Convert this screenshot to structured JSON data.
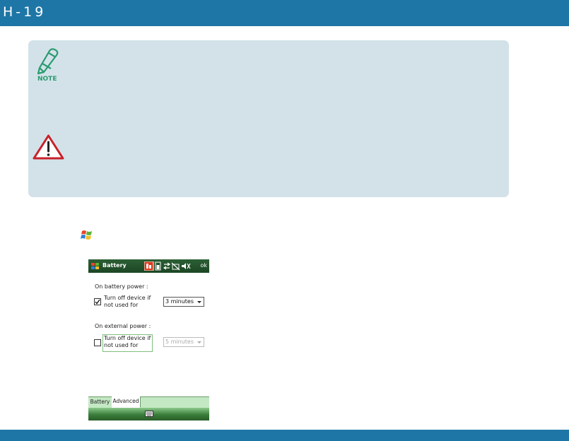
{
  "header": {
    "title": "H-19"
  },
  "note": {
    "label": "NOTE"
  },
  "device": {
    "title": "Battery",
    "ok_label": "ok",
    "battery_section": "On battery power :",
    "battery_check_label_1": "Turn off device if",
    "battery_check_label_2": "not used for",
    "battery_checked": true,
    "battery_value": "3 minutes",
    "external_section": "On external power :",
    "external_check_label_1": "Turn off device if",
    "external_check_label_2": "not used for",
    "external_checked": false,
    "external_value": "5 minutes",
    "tabs": [
      {
        "label": "Battery"
      },
      {
        "label": "Advanced"
      }
    ]
  },
  "colors": {
    "header_bg": "#1e76a6",
    "note_bg": "#d3e2e9",
    "note_green": "#2a9b6f",
    "warning_red": "#c8202a"
  }
}
